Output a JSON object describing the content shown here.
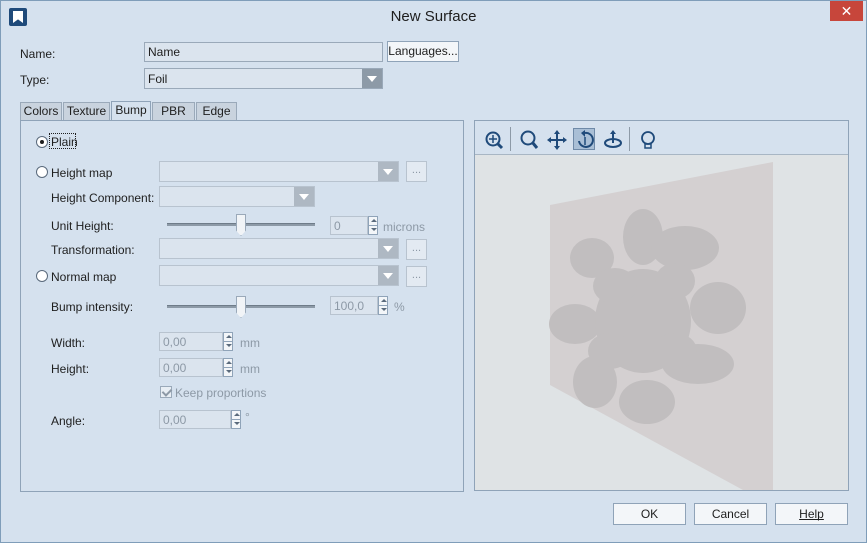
{
  "window": {
    "title": "New Surface",
    "close_glyph": "✕"
  },
  "form": {
    "name_label": "Name:",
    "name_value": "Name",
    "languages_button": "Languages...",
    "type_label": "Type:",
    "type_value": "Foil"
  },
  "tabs": [
    {
      "label": "Colors",
      "active": false
    },
    {
      "label": "Texture",
      "active": false
    },
    {
      "label": "Bump",
      "active": true
    },
    {
      "label": "PBR",
      "active": false
    },
    {
      "label": "Edge",
      "active": false
    }
  ],
  "bump": {
    "plain_label": "Plain",
    "height_map_label": "Height map",
    "height_map_value": "",
    "height_component_label": "Height Component:",
    "unit_height_label": "Unit Height:",
    "unit_height_slider_fraction": 0.5,
    "unit_height_value": "0",
    "unit_height_unit": "microns",
    "transformation_label": "Transformation:",
    "normal_map_label": "Normal map",
    "bump_intensity_label": "Bump intensity:",
    "bump_intensity_slider_fraction": 0.5,
    "bump_intensity_value": "100,0",
    "bump_intensity_unit": "%",
    "width_label": "Width:",
    "width_value": "0,00",
    "width_unit": "mm",
    "height_label": "Height:",
    "height_value": "0,00",
    "height_unit": "mm",
    "keep_proportions_label": "Keep proportions",
    "keep_proportions_checked": true,
    "angle_label": "Angle:",
    "angle_value": "0,00",
    "angle_unit": "°",
    "ellipsis": "..."
  },
  "preview": {
    "tools": [
      "zoom-fit-icon",
      "zoom-icon",
      "pan-icon",
      "rotate-icon",
      "orbit-icon",
      "light-bulb-icon"
    ],
    "pressed_tool": "rotate-icon"
  },
  "footer": {
    "ok": "OK",
    "cancel": "Cancel",
    "help": "Help"
  },
  "colors": {
    "accent": "#1f4a7a",
    "close": "#c7463b",
    "background": "#d5e1ee"
  }
}
